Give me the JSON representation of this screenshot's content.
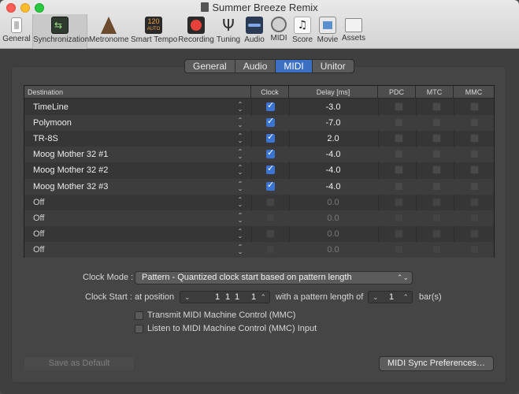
{
  "window": {
    "title": "Summer Breeze Remix"
  },
  "toolbar": {
    "items": [
      {
        "label": "General",
        "icon": "general-icon"
      },
      {
        "label": "Synchronization",
        "icon": "sync-icon"
      },
      {
        "label": "Metronome",
        "icon": "metronome-icon"
      },
      {
        "label": "Smart Tempo",
        "icon": "smart-tempo-icon",
        "badge_top": "120",
        "badge_bottom": "AUTO"
      },
      {
        "label": "Recording",
        "icon": "record-icon"
      },
      {
        "label": "Tuning",
        "icon": "tuning-fork-icon"
      },
      {
        "label": "Audio",
        "icon": "audio-icon"
      },
      {
        "label": "MIDI",
        "icon": "midi-icon"
      },
      {
        "label": "Score",
        "icon": "score-icon"
      },
      {
        "label": "Movie",
        "icon": "movie-icon"
      },
      {
        "label": "Assets",
        "icon": "assets-icon"
      }
    ]
  },
  "tabs": [
    "General",
    "Audio",
    "MIDI",
    "Unitor"
  ],
  "table": {
    "headers": {
      "destination": "Destination",
      "clock": "Clock",
      "delay": "Delay [ms]",
      "pdc": "PDC",
      "mtc": "MTC",
      "mmc": "MMC"
    },
    "rows": [
      {
        "destination": "TimeLine",
        "clock": true,
        "delay": "-3.0"
      },
      {
        "destination": "Polymoon",
        "clock": true,
        "delay": "-7.0"
      },
      {
        "destination": "TR-8S",
        "clock": true,
        "delay": "2.0"
      },
      {
        "destination": "Moog Mother 32 #1",
        "clock": true,
        "delay": "-4.0"
      },
      {
        "destination": "Moog Mother 32 #2",
        "clock": true,
        "delay": "-4.0"
      },
      {
        "destination": "Moog Mother 32 #3",
        "clock": true,
        "delay": "-4.0"
      },
      {
        "destination": "Off",
        "clock": false,
        "delay": "0.0"
      },
      {
        "destination": "Off",
        "clock": false,
        "delay": "0.0"
      },
      {
        "destination": "Off",
        "clock": false,
        "delay": "0.0"
      },
      {
        "destination": "Off",
        "clock": false,
        "delay": "0.0"
      }
    ]
  },
  "clock_mode": {
    "label": "Clock Mode :",
    "value": "Pattern - Quantized clock start based on pattern length"
  },
  "clock_start": {
    "label": "Clock Start :",
    "at_position_label": "at position",
    "position": [
      "1",
      "1",
      "1",
      "1"
    ],
    "pattern_length_label": "with a pattern length of",
    "pattern_length": "1",
    "unit": "bar(s)"
  },
  "options": {
    "transmit_mmc": "Transmit MIDI Machine Control (MMC)",
    "listen_mmc": "Listen to MIDI Machine Control (MMC) Input"
  },
  "buttons": {
    "save_default": "Save as Default",
    "midi_sync_prefs": "MIDI Sync Preferences…"
  },
  "colors": {
    "accent": "#3a6fc2",
    "record": "#e8413a"
  }
}
